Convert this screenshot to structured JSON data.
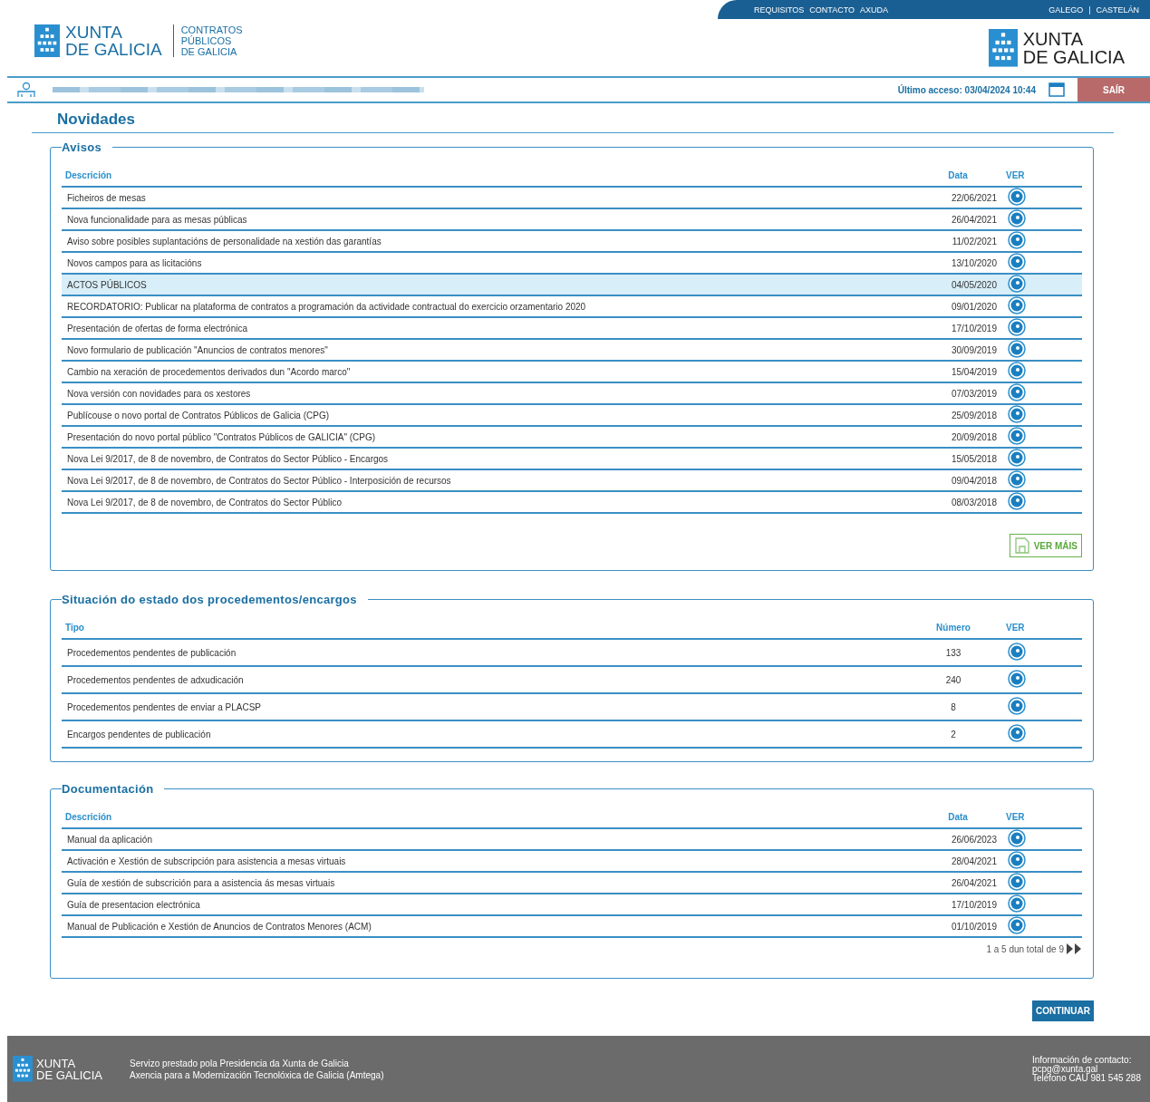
{
  "top_nav": {
    "links": [
      "REQUISITOS",
      "CONTACTO",
      "AXUDA"
    ],
    "languages": [
      "GALEGO",
      "CASTELÁN"
    ],
    "separator": "|"
  },
  "header": {
    "logo_left": {
      "line1": "XUNTA",
      "line2": "DE GALICIA"
    },
    "portal": [
      "CONTRATOS",
      "PÚBLICOS",
      "DE GALICIA"
    ],
    "logo_right": {
      "line1": "XUNTA",
      "line2": "DE GALICIA"
    }
  },
  "user_bar": {
    "last_access": "Último acceso: 03/04/2024 10:44",
    "logout": "SAÍR"
  },
  "page_title": "Novidades",
  "avisos": {
    "legend": "Avisos",
    "columns": [
      "Descrición",
      "Data",
      "VER"
    ],
    "rows": [
      {
        "description": "Ficheiros de mesas",
        "date": "22/06/2021",
        "selected": false
      },
      {
        "description": "Nova funcionalidade para as mesas públicas",
        "date": "26/04/2021",
        "selected": false
      },
      {
        "description": "Aviso sobre posibles suplantacións de personalidade na xestión das garantías",
        "date": "11/02/2021",
        "selected": false
      },
      {
        "description": "Novos campos para as licitacións",
        "date": "13/10/2020",
        "selected": false
      },
      {
        "description": "ACTOS PÚBLICOS",
        "date": "04/05/2020",
        "selected": true
      },
      {
        "description": "RECORDATORIO: Publicar na plataforma de contratos a programación da actividade contractual do exercicio orzamentario 2020",
        "date": "09/01/2020",
        "selected": false
      },
      {
        "description": "Presentación de ofertas de forma electrónica",
        "date": "17/10/2019",
        "selected": false
      },
      {
        "description": "Novo formulario de publicación \"Anuncios de contratos menores\"",
        "date": "30/09/2019",
        "selected": false
      },
      {
        "description": "Cambio na xeración de procedementos derivados dun \"Acordo marco\"",
        "date": "15/04/2019",
        "selected": false
      },
      {
        "description": "Nova versión con novidades para os xestores",
        "date": "07/03/2019",
        "selected": false
      },
      {
        "description": "Publícouse o novo portal de Contratos Públicos de Galicia (CPG)",
        "date": "25/09/2018",
        "selected": false
      },
      {
        "description": "Presentación do novo portal público \"Contratos Públicos de GALICIA\" (CPG)",
        "date": "20/09/2018",
        "selected": false
      },
      {
        "description": "Nova Lei 9/2017, de 8 de novembro, de Contratos do Sector Público - Encargos",
        "date": "15/05/2018",
        "selected": false
      },
      {
        "description": "Nova Lei 9/2017, de 8 de novembro, de Contratos do Sector Público - Interposición de recursos",
        "date": "09/04/2018",
        "selected": false
      },
      {
        "description": "Nova Lei 9/2017, de 8 de novembro, de Contratos do Sector Público",
        "date": "08/03/2018",
        "selected": false
      }
    ],
    "more": "VER MÁIS"
  },
  "situacion": {
    "legend": "Situación do estado dos procedementos/encargos",
    "columns": [
      "Tipo",
      "Número",
      "VER"
    ],
    "rows": [
      {
        "type": "Procedementos pendentes de publicación",
        "number": "133"
      },
      {
        "type": "Procedementos pendentes de adxudicación",
        "number": "240"
      },
      {
        "type": "Procedementos pendentes de enviar a PLACSP",
        "number": "8"
      },
      {
        "type": "Encargos pendentes de publicación",
        "number": "2"
      }
    ]
  },
  "documentacion": {
    "legend": "Documentación",
    "columns": [
      "Descrición",
      "Data",
      "VER"
    ],
    "rows": [
      {
        "description": "Manual da aplicación",
        "date": "26/06/2023"
      },
      {
        "description": "Activación e Xestión de subscripción para asistencia a mesas virtuais",
        "date": "28/04/2021"
      },
      {
        "description": "Guía de xestión de subscrición para a asistencia ás mesas virtuais",
        "date": "26/04/2021"
      },
      {
        "description": "Guía de presentacion electrónica",
        "date": "17/10/2019"
      },
      {
        "description": "Manual de Publicación e Xestión de Anuncios de Contratos Menores (ACM)",
        "date": "01/10/2019"
      }
    ],
    "pagination": "1 a 5 dun total de 9"
  },
  "continue_button": "CONTINUAR",
  "footer": {
    "logo": {
      "line1": "XUNTA",
      "line2": "DE GALICIA"
    },
    "service": [
      "Servizo prestado pola Presidencia da Xunta de Galicia",
      "Axencia para a Modernización Tecnolóxica de Galicia (Amtega)"
    ],
    "contact": [
      "Información de contacto:",
      "pcpg@xunta.gal",
      "Teléfono CAU 981 545 288"
    ]
  }
}
